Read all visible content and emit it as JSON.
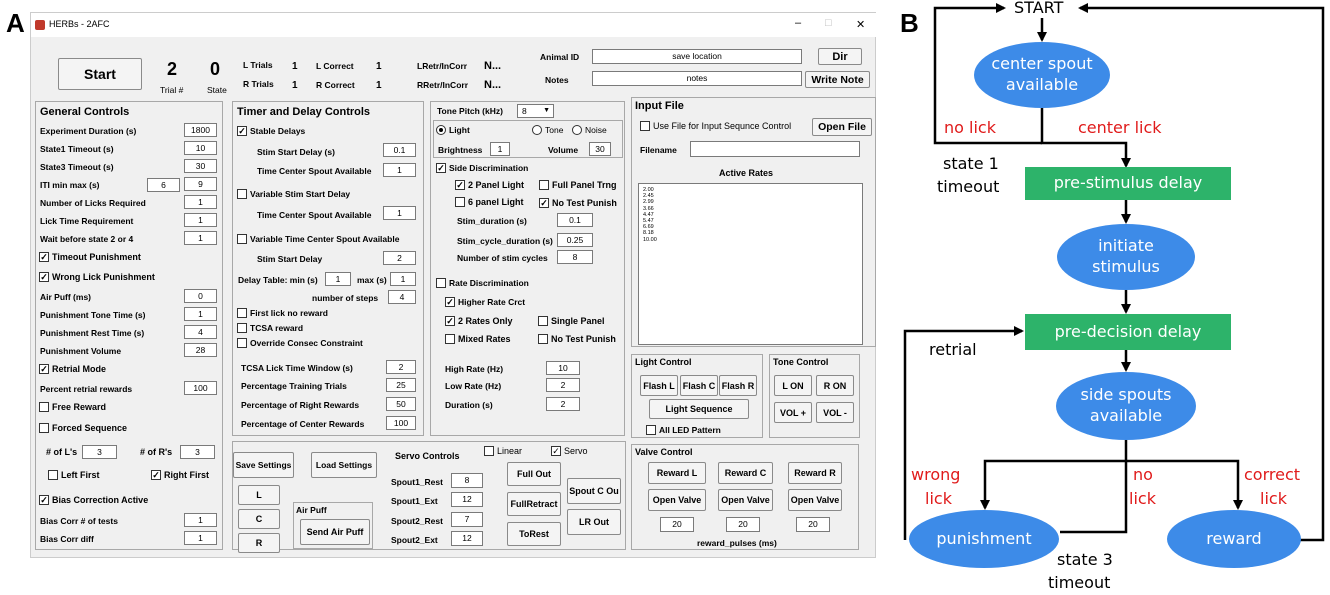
{
  "panels": {
    "a": "A",
    "b": "B"
  },
  "window": {
    "title": "HERBs - 2AFC",
    "min": "–",
    "max": "□",
    "close": "✕"
  },
  "top": {
    "start": "Start",
    "trial_val": "2",
    "trial_lbl": "Trial #",
    "state_val": "0",
    "state_lbl": "State",
    "l_trials": "L Trials",
    "l_trials_val": "1",
    "r_trials": "R Trials",
    "r_trials_val": "1",
    "l_correct": "L Correct",
    "l_correct_val": "1",
    "r_correct": "R Correct",
    "r_correct_val": "1",
    "lretr": "LRetr/InCorr",
    "lretr_val": "N...",
    "rretr": "RRetr/InCorr",
    "rretr_val": "N...",
    "animal_id": "Animal ID",
    "animal_val": "save location",
    "dir": "Dir",
    "notes": "Notes",
    "notes_val": "notes",
    "write_note": "Write Note"
  },
  "general": {
    "title": "General Controls",
    "rows": [
      {
        "l": "Experiment Duration (s)",
        "v": "1800"
      },
      {
        "l": "State1 Timeout (s)",
        "v": "10"
      },
      {
        "l": "State3 Timeout (s)",
        "v": "30"
      },
      {
        "l": "ITI  min  max (s)",
        "v": "9",
        "v2": "6"
      },
      {
        "l": "Number of Licks Required",
        "v": "1"
      },
      {
        "l": "Lick Time Requirement",
        "v": "1"
      },
      {
        "l": "Wait before state 2 or 4",
        "v": "1"
      }
    ],
    "timeout_pun": "Timeout Punishment",
    "wrong_lick": "Wrong Lick Punishment",
    "rows2": [
      {
        "l": "Air Puff (ms)",
        "v": "0"
      },
      {
        "l": "Punishment Tone Time (s)",
        "v": "1"
      },
      {
        "l": "Punishment Rest Time (s)",
        "v": "4"
      },
      {
        "l": "Punishment Volume",
        "v": "28"
      }
    ],
    "retrial": "Retrial Mode",
    "pct_retrial": "Percent retrial rewards",
    "pct_retrial_v": "100",
    "free_reward": "Free Reward",
    "forced_seq": "Forced Sequence",
    "num_l": "# of L's",
    "num_l_v": "3",
    "num_r": "# of R's",
    "num_r_v": "3",
    "left_first": "Left First",
    "right_first": "Right First",
    "bias": "Bias Correction Active",
    "bias_tests": "Bias Corr # of tests",
    "bias_tests_v": "1",
    "bias_diff": "Bias Corr  diff",
    "bias_diff_v": "1"
  },
  "timer": {
    "title": "Timer and Delay Controls",
    "stable": "Stable Delays",
    "stim_start": "Stim Start Delay (s)",
    "stim_start_v": "0.1",
    "tcsa": "Time Center Spout Available",
    "tcsa_v": "1",
    "var_stim": "Variable Stim Start Delay",
    "tcsa2": "Time Center Spout Available",
    "tcsa2_v": "1",
    "var_time": "Variable Time Center Spout Available",
    "ssd": "Stim Start Delay",
    "ssd_v": "2",
    "delay_table": "Delay Table:  min (s)",
    "dt_min": "1",
    "dt_max_l": "max (s)",
    "dt_max": "1",
    "steps": "number of steps",
    "steps_v": "4",
    "first_lick": "First lick no reward",
    "tcsa_reward": "TCSA reward",
    "override": "Override Consec Constraint",
    "rows": [
      {
        "l": "TCSA Lick Time Window (s)",
        "v": "2"
      },
      {
        "l": "Percentage Training Trials",
        "v": "25"
      },
      {
        "l": "Percentage of Right Rewards",
        "v": "50"
      },
      {
        "l": "Percentage of Center Rewards",
        "v": "100"
      }
    ]
  },
  "tone": {
    "pitch": "Tone Pitch (kHz)",
    "pitch_v": "8",
    "light": "Light",
    "tone": "Tone",
    "noise": "Noise",
    "brightness": "Brightness",
    "brightness_v": "1",
    "volume": "Volume",
    "volume_v": "30",
    "side_disc": "Side Discrimination",
    "two_panel": "2 Panel Light",
    "full_panel": "Full Panel Trng",
    "six_panel": "6 panel Light",
    "no_test": "No Test Punish",
    "stim_dur": "Stim_duration (s)",
    "stim_dur_v": "0.1",
    "stim_cycle": "Stim_cycle_duration (s)",
    "stim_cycle_v": "0.25",
    "num_cycles": "Number of stim cycles",
    "num_cycles_v": "8",
    "rate_disc": "Rate Discrimination",
    "higher_rate": "Higher Rate Crct",
    "two_rates": "2 Rates Only",
    "single_panel": "Single Panel",
    "mixed_rates": "Mixed Rates",
    "no_test2": "No Test Punish",
    "high_rate": "High Rate (Hz)",
    "high_rate_v": "10",
    "low_rate": "Low Rate (Hz)",
    "low_rate_v": "2",
    "duration": "Duration (s)",
    "duration_v": "2"
  },
  "input": {
    "title": "Input File",
    "use_file": "Use File for Input Sequnce Control",
    "open_file": "Open File",
    "filename": "Filename",
    "active_rates": "Active Rates",
    "rates": [
      "2.00",
      "2.45",
      "2.99",
      "3.66",
      "4.47",
      "5.47",
      "6.69",
      "8.18",
      "10.00"
    ]
  },
  "light": {
    "title": "Light Control",
    "flash_l": "Flash L",
    "flash_c": "Flash C",
    "flash_r": "Flash R",
    "seq": "Light Sequence",
    "all_led": "All LED Pattern"
  },
  "tonectl": {
    "title": "Tone Control",
    "l_on": "L ON",
    "r_on": "R ON",
    "vol_up": "VOL +",
    "vol_down": "VOL -"
  },
  "valve": {
    "title": "Valve Control",
    "reward_l": "Reward L",
    "reward_c": "Reward C",
    "reward_r": "Reward R",
    "open": "Open Valve",
    "p1": "20",
    "p2": "20",
    "p3": "20",
    "pulses": "reward_pulses (ms)"
  },
  "bottom": {
    "save": "Save Settings",
    "load": "Load Settings",
    "l": "L",
    "c": "C",
    "r": "R",
    "air_puff": "Air Puff",
    "send_air": "Send Air Puff",
    "servo_ctrl": "Servo Controls",
    "linear": "Linear",
    "servo": "Servo",
    "servo_rows": [
      {
        "l": "Spout1_Rest",
        "v": "8"
      },
      {
        "l": "Spout1_Ext",
        "v": "12"
      },
      {
        "l": "Spout2_Rest",
        "v": "7"
      },
      {
        "l": "Spout2_Ext",
        "v": "12"
      }
    ],
    "full_out": "Full Out",
    "full_retract": "FullRetract",
    "to_rest": "ToRest",
    "spout_c": "Spout C Ou",
    "lr_out": "LR Out"
  },
  "flow": {
    "start": "START",
    "center_spout": "center spout available",
    "pre_stim": "pre-stimulus delay",
    "initiate": "initiate stimulus",
    "pre_dec": "pre-decision delay",
    "side_spouts": "side spouts available",
    "punishment": "punishment",
    "reward": "reward",
    "no_lick1": "no lick",
    "center_lick": "center lick",
    "state1": "state 1",
    "timeout1": "timeout",
    "retrial": "retrial",
    "wrong": "wrong",
    "lick_w": "lick",
    "no2": "no",
    "lick_n": "lick",
    "correct": "correct",
    "lick_c": "lick",
    "state3": "state 3",
    "timeout3": "timeout"
  },
  "colors": {
    "ellipse": "#3d8be8",
    "rect": "#2db36a",
    "red_label": "#e01b1b",
    "gui_bg": "#f0f0f0"
  }
}
